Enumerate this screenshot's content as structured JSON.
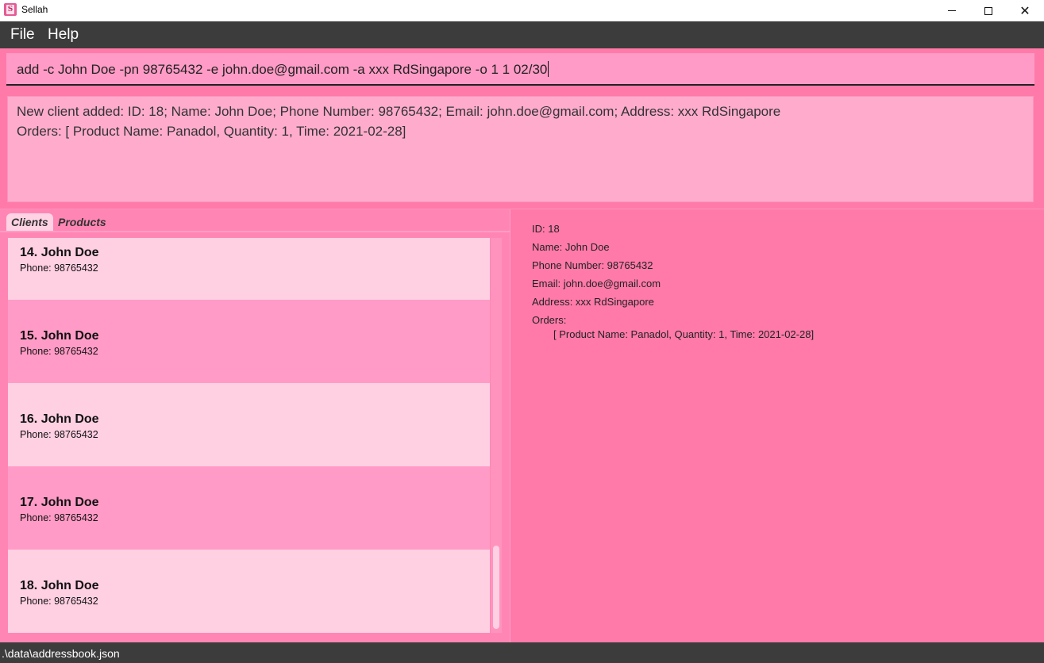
{
  "window": {
    "title": "Sellah",
    "icon": "sellah-app-icon"
  },
  "menu": {
    "file": "File",
    "help": "Help"
  },
  "command": {
    "value": "add -c John Doe -pn 98765432 -e john.doe@gmail.com -a xxx RdSingapore -o 1 1 02/30"
  },
  "result": {
    "line1": "New client added: ID: 18; Name: John Doe; Phone Number: 98765432; Email: john.doe@gmail.com; Address: xxx RdSingapore",
    "line2": "Orders: [ Product Name: Panadol, Quantity: 1, Time: 2021-02-28]"
  },
  "tabs": {
    "clients": "Clients",
    "products": "Products"
  },
  "clients": [
    {
      "name": "14.  John Doe",
      "phone": "Phone: 98765432"
    },
    {
      "name": "15.  John Doe",
      "phone": "Phone: 98765432"
    },
    {
      "name": "16.  John Doe",
      "phone": "Phone: 98765432"
    },
    {
      "name": "17.  John Doe",
      "phone": "Phone: 98765432"
    },
    {
      "name": "18.  John Doe",
      "phone": "Phone: 98765432"
    }
  ],
  "details": {
    "id": "ID: 18",
    "name": "Name: John Doe",
    "phone": "Phone Number: 98765432",
    "email": "Email: john.doe@gmail.com",
    "address": "Address: xxx RdSingapore",
    "orders_label": "Orders:",
    "order_1": "[ Product Name: Panadol, Quantity: 1, Time: 2021-02-28]"
  },
  "status": {
    "path": ".\\data\\addressbook.json"
  },
  "colors": {
    "accent": "#ff7aa9",
    "menubar": "#3c3c3c",
    "card_light": "#ffcfe2",
    "card_dark": "#ff9bc6"
  }
}
